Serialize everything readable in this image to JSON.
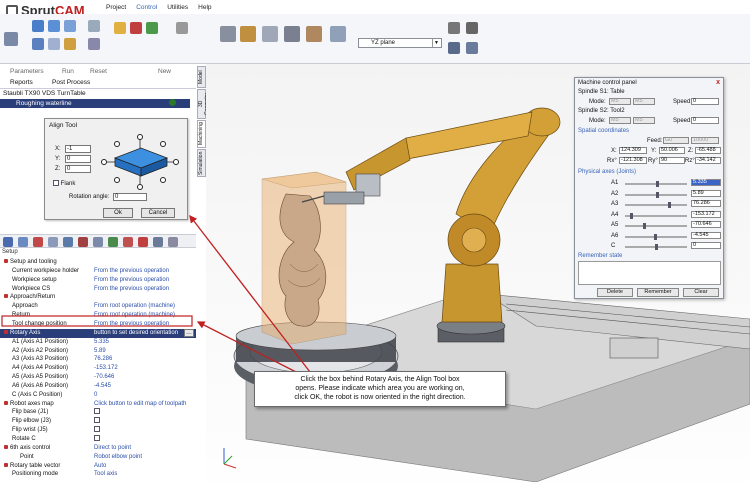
{
  "app": {
    "name_part1": "Sprut",
    "name_part2": "CAM"
  },
  "menu": [
    "Project",
    "Control",
    "Utilities",
    "Help"
  ],
  "ribbon": {
    "plane_select": "YZ plane"
  },
  "left_toolbar": {
    "parameters": "Parameters",
    "run": "Run",
    "reset": "Reset",
    "new": "New",
    "reports": "Reports",
    "post_process": "Post Process"
  },
  "operations": [
    "Staubli TX90 VDS TurnTable",
    "Roughing waterline"
  ],
  "align_tool": {
    "title": "Align Tool",
    "x_label": "X:",
    "x_value": "-1",
    "y_label": "Y:",
    "y_value": "0",
    "z_label": "Z:",
    "z_value": "0",
    "flank": "Flank",
    "rotation_label": "Rotation angle:",
    "rotation_value": "0",
    "ok": "Ok",
    "cancel": "Cancel"
  },
  "tree": {
    "setup": "Setup",
    "rows": [
      {
        "k": "Setup and tooling",
        "v": "",
        "level": 0,
        "bullet": true
      },
      {
        "k": "Current workpiece holder",
        "v": "From the previous operation",
        "level": 1
      },
      {
        "k": "Workpiece setup",
        "v": "From the previous operation",
        "level": 1
      },
      {
        "k": "Workpiece CS",
        "v": "From the previous operation",
        "level": 1
      },
      {
        "k": "Approach/Return",
        "v": "",
        "level": 0,
        "bullet": true
      },
      {
        "k": "Approach",
        "v": "From root operation (machine)",
        "level": 1
      },
      {
        "k": "Return",
        "v": "From root operation (machine)",
        "level": 1
      },
      {
        "k": "Tool change position",
        "v": "From the previous operation",
        "level": 1
      },
      {
        "k": "Rotary Axis",
        "v": "button to set desired orientation",
        "level": 0,
        "bullet": true,
        "selected": true
      },
      {
        "k": "A1 (Axis A1 Position)",
        "v": "5.335",
        "level": 1
      },
      {
        "k": "A2 (Axis A2 Position)",
        "v": "5.89",
        "level": 1
      },
      {
        "k": "A3 (Axis A3 Position)",
        "v": "76.286",
        "level": 1
      },
      {
        "k": "A4 (Axis A4 Position)",
        "v": "-153.172",
        "level": 1
      },
      {
        "k": "A5 (Axis A5 Position)",
        "v": "-70.646",
        "level": 1
      },
      {
        "k": "A6 (Axis A6 Position)",
        "v": "-4.545",
        "level": 1
      },
      {
        "k": "C (Axis C Position)",
        "v": "0",
        "level": 1
      },
      {
        "k": "Robot axes map",
        "v": "Click button to edit map of toolpath",
        "level": 0,
        "bullet": true
      },
      {
        "k": "Flip base (J1)",
        "v": "",
        "level": 1,
        "check": true
      },
      {
        "k": "Flip elbow (J3)",
        "v": "",
        "level": 1,
        "check": true
      },
      {
        "k": "Flip wrist (J5)",
        "v": "",
        "level": 1,
        "check": true
      },
      {
        "k": "Rotate C",
        "v": "",
        "level": 1,
        "check": true
      },
      {
        "k": "6th axis control",
        "v": "Direct to point",
        "level": 0,
        "bullet": true
      },
      {
        "k": "Point",
        "v": "Robot elbow point",
        "level": 2
      },
      {
        "k": "Rotary table vector",
        "v": "Auto",
        "level": 0,
        "bullet": true
      },
      {
        "k": "Positioning mode",
        "v": "Tool axis",
        "level": 1
      }
    ]
  },
  "side_tabs": [
    "Model",
    "3D Geometry",
    "Machining",
    "Simulation"
  ],
  "machine_panel": {
    "title": "Machine control panel",
    "close": "x",
    "spindle1": "Spindle S1: Table",
    "spindle2": "Spindle S2: Tool2",
    "mode_label": "Mode:",
    "mode_val1": "M5",
    "mode_val2": "M5",
    "speed_label": "Speed:",
    "speed_val": "0",
    "spatial": "Spatial coordinates",
    "feed_label": "Feed:",
    "feed_mode": "G0",
    "feed_val": "10000",
    "x_label": "X:",
    "x_val": "124.309",
    "y_label": "Y:",
    "y_val": "50.006",
    "z_label": "Z:",
    "z_val": "-65.488",
    "rx_label": "Rx°",
    "rx_val": "-121.308",
    "ry_label": "Ry°",
    "ry_val": "90",
    "rz_label": "Rz°",
    "rz_val": "-34.142",
    "physical": "Physical axes (Joints)",
    "joints": [
      {
        "name": "A1",
        "value": "5.335",
        "pos": 0.52
      },
      {
        "name": "A2",
        "value": "5.89",
        "pos": 0.52
      },
      {
        "name": "A3",
        "value": "76.286",
        "pos": 0.72
      },
      {
        "name": "A4",
        "value": "-153.172",
        "pos": 0.08
      },
      {
        "name": "A5",
        "value": "-70.646",
        "pos": 0.3
      },
      {
        "name": "A6",
        "value": "-4.545",
        "pos": 0.49
      },
      {
        "name": "C",
        "value": "0",
        "pos": 0.5
      }
    ],
    "remember": "Remember state",
    "delete": "Delete",
    "remember_btn": "Remember",
    "clear": "Clear"
  },
  "callout": {
    "line1": "Click the box behind Rotary Axis, the Align Tool box",
    "line2": "opens.  Please indicate which area you are working on,",
    "line3": "click OK, the robot is now oriented in the right direction."
  }
}
